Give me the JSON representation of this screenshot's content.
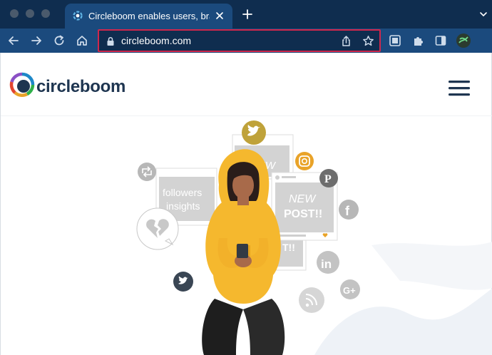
{
  "browser": {
    "tab": {
      "title": "Circleboom enables users, brands",
      "favicon": "circleboom-favicon-icon"
    },
    "address_bar": {
      "url": "circleboom.com"
    },
    "icons": [
      "back-arrow-icon",
      "forward-arrow-icon",
      "reload-icon",
      "home-icon",
      "lock-icon",
      "share-icon",
      "bookmark-star-icon",
      "screenshot-extension-icon",
      "extensions-puzzle-icon",
      "side-panel-icon",
      "profile-avatar-icon",
      "tab-search-chevron-icon"
    ]
  },
  "site": {
    "logo_text": "circleboom",
    "menu_icon": "hamburger-menu-icon"
  },
  "hero": {
    "card_followers_line1": "followers",
    "card_followers_line2": "insights",
    "card_new_post_line1": "NEW",
    "card_new_post_line2": "POST!!",
    "card_back_post": "NEW",
    "card_back_post_suffix": "T!!",
    "icons": [
      "twitter-icon",
      "instagram-icon",
      "pinterest-icon",
      "facebook-icon",
      "linkedin-icon",
      "google-plus-icon",
      "rss-icon",
      "retweet-icon",
      "broken-heart-icon"
    ]
  },
  "colors": {
    "tabbar": "#0f2d4f",
    "toolbar": "#1b4a7d",
    "address_highlight": "#d0274c",
    "hoodie": "#f5b82e",
    "logo_navy": "#1e3550"
  }
}
